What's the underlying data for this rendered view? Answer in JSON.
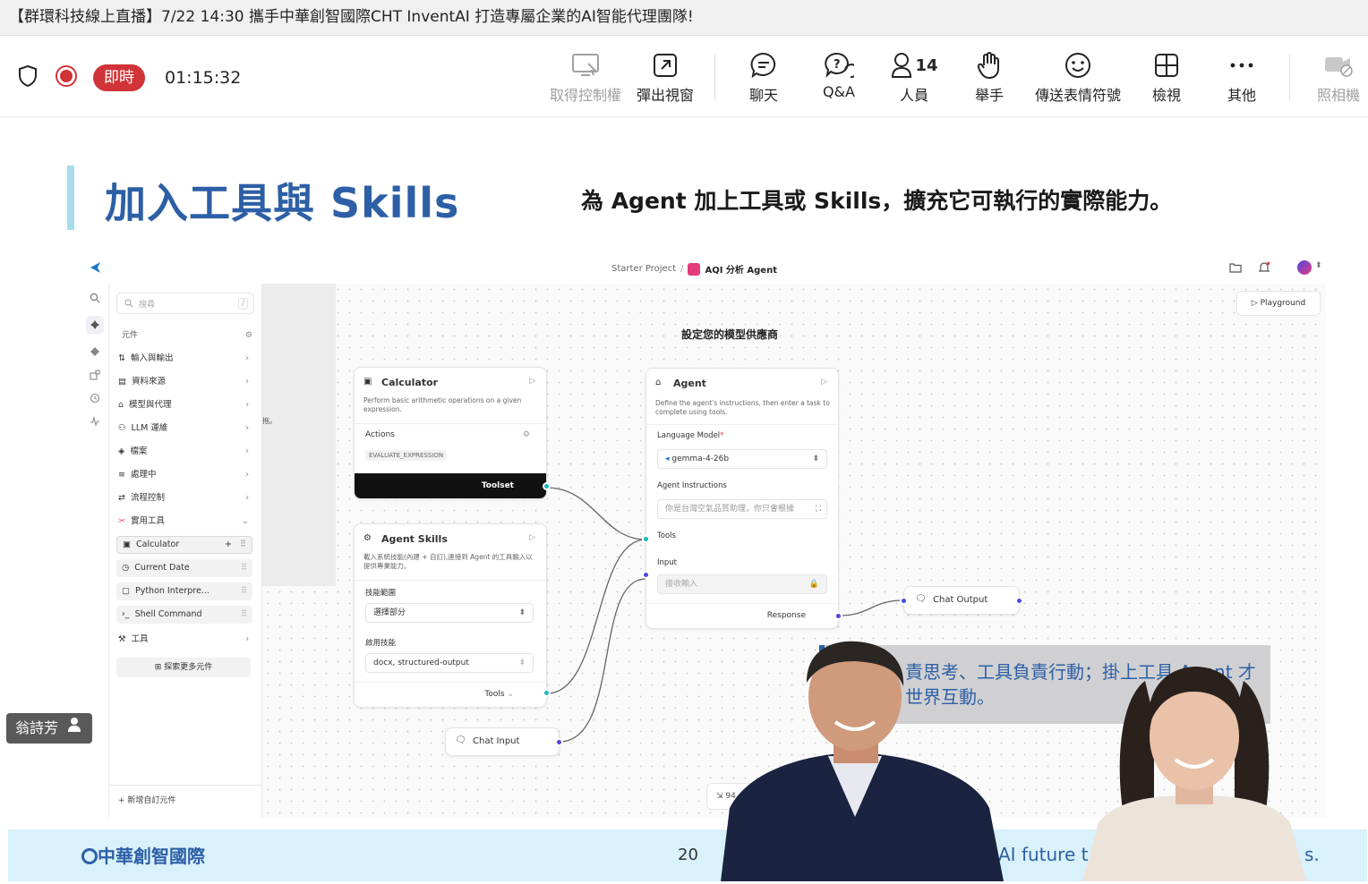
{
  "window_title": "【群環科技線上直播】7/22 14:30 攜手中華創智國際CHT InventAI 打造專屬企業的AI智能代理團隊!",
  "meeting": {
    "live_label": "即時",
    "timer": "01:15:32",
    "participant_count": "14"
  },
  "toolbar": {
    "take_control": "取得控制權",
    "pop_out": "彈出視窗",
    "chat": "聊天",
    "qa": "Q&A",
    "people": "人員",
    "raise_hand": "舉手",
    "reactions": "傳送表情符號",
    "view": "檢視",
    "more": "其他",
    "camera": "照相機"
  },
  "slide": {
    "title": "加入工具與 Skills",
    "subtitle": "為 Agent 加上工具或 Skills，擴充它可執行的實際能力。",
    "page_number": "20",
    "footer_logo": "中華創智國際",
    "footer_tagline_fragment": "AI future t",
    "footer_tagline_end": "s.",
    "overlay_line1": "責思考、工具負責行動；掛上工具 Agent 才",
    "overlay_line2": "世界互動。"
  },
  "app": {
    "breadcrumb_project": "Starter Project",
    "breadcrumb_sep": "/",
    "flow_name": "AQI 分析 Agent",
    "playground_label": "Playground",
    "search_placeholder": "搜尋",
    "search_shortcut": "/",
    "components_header": "元件",
    "categories": [
      {
        "label": "輸入與輸出"
      },
      {
        "label": "資料來源"
      },
      {
        "label": "模型與代理"
      },
      {
        "label": "LLM 運維"
      },
      {
        "label": "檔案"
      },
      {
        "label": "處理中"
      },
      {
        "label": "流程控制"
      },
      {
        "label": "實用工具"
      }
    ],
    "utility_tools": [
      {
        "label": "Calculator"
      },
      {
        "label": "Current Date"
      },
      {
        "label": "Python Interpre..."
      },
      {
        "label": "Shell Command"
      }
    ],
    "tools_category": "工具",
    "explore_more": "探索更多元件",
    "add_custom": "新增自訂元件",
    "canvas_note": "設定您的模型供應商",
    "calculator_node": {
      "title": "Calculator",
      "desc": "Perform basic arithmetic operations on a given expression.",
      "actions_label": "Actions",
      "action_tag": "EVALUATE_EXPRESSION",
      "output_label": "Toolset"
    },
    "skills_node": {
      "title": "Agent Skills",
      "desc": "載入系統技能(內建 + 自訂),連接到 Agent 的工具輸入以提供專業能力。",
      "scope_label": "技能範圍",
      "scope_value": "選擇部分",
      "enabled_label": "啟用技能",
      "enabled_value": "docx, structured-output",
      "output_label": "Tools"
    },
    "agent_node": {
      "title": "Agent",
      "desc": "Define the agent's instructions, then enter a task to complete using tools.",
      "model_label": "Language Model",
      "model_value": "gemma-4-26b",
      "instructions_label": "Agent Instructions",
      "instructions_value": "你是台灣空氣品質助理，你只會根據",
      "tools_label": "Tools",
      "input_label": "Input",
      "input_placeholder": "接收輸入",
      "output_label": "Response"
    },
    "chat_input_node": {
      "title": "Chat Input"
    },
    "chat_output_node": {
      "title": "Chat Output"
    },
    "left_panel_fragment": "拖。",
    "zoom_fragment": "94"
  },
  "presenter": {
    "name": "翁詩芳"
  },
  "colors": {
    "live_red": "#d13438",
    "slide_title_blue": "#2d5fa6",
    "slide_accent": "#a9dcef",
    "footer_bg": "#d9f1fb",
    "handle_blue": "#4f46e5",
    "handle_teal": "#14b8c4"
  }
}
